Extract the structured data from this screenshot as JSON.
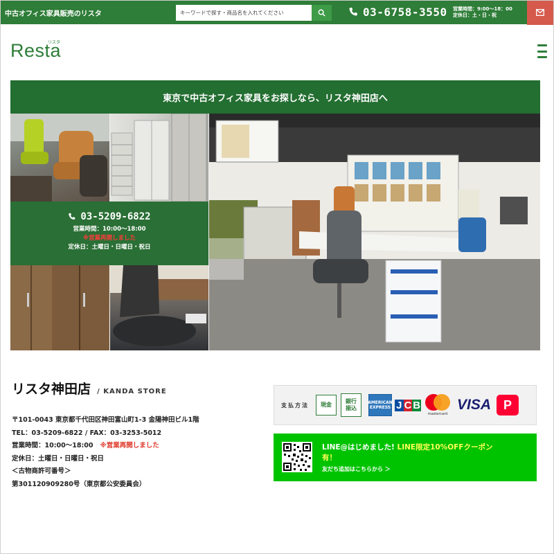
{
  "topbar": {
    "tagline": "中古オフィス家具販売のリスタ",
    "search_placeholder": "キーワードで探す・商品名を入れてください",
    "phone": "03-6758-3550",
    "hours_line1": "営業時間：9:00〜18：00",
    "hours_line2": "定休日：土・日・祝",
    "colors": {
      "bar": "#2e7d38",
      "mail": "#d55a4c"
    }
  },
  "header": {
    "logo_text": "Resta",
    "logo_ruby": "リスタ"
  },
  "banner": {
    "text": "東京で中古オフィス家具をお探しなら、リスタ神田店へ"
  },
  "hero": {
    "phone": "03-5209-6822",
    "hours": "営業時間：10:00〜18:00",
    "notice": "※営業再開しました",
    "holidays": "定休日：土曜日・日曜日・祝日"
  },
  "store": {
    "name": "リスタ神田店",
    "name_en": "/ KANDA STORE",
    "address": "〒101-0043 東京都千代田区神田富山町1-3 金陽神田ビル1階",
    "tel_fax": "TEL：03-5209-6822 / FAX：03-3253-5012",
    "hours": "営業時間：10:00〜18:00",
    "notice": "※営業再開しました",
    "holidays": "定休日：土曜日・日曜日・祝日",
    "license_label": "＜古物商許可番号＞",
    "license_number": "第301120909280号（東京都公安委員会）"
  },
  "payment": {
    "label": "支払方法",
    "cash": "現金",
    "bank_line1": "銀行",
    "bank_line2": "振込",
    "amex_line1": "AMERICAN",
    "amex_line2": "EXPRESS",
    "jcb": [
      "J",
      "C",
      "B"
    ],
    "mastercard": "mastercard",
    "visa": "VISA",
    "paypay": "P"
  },
  "line": {
    "title_white": "LINE@はじめました! ",
    "title_yellow": "LINE限定10%OFFクーポン",
    "title_end": "有！",
    "link": "友だち追加はこちらから ＞",
    "color": "#00c300"
  }
}
